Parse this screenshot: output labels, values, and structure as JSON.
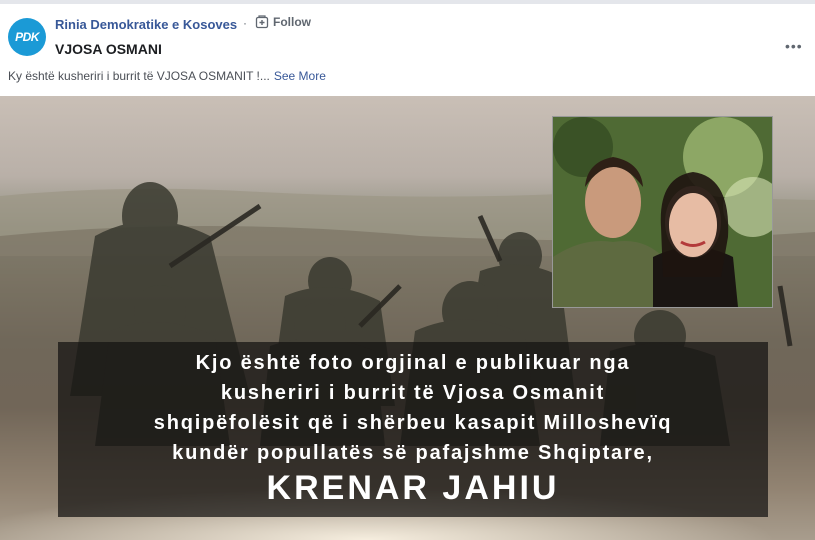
{
  "post": {
    "page_name": "Rinia Demokratike e Kosoves",
    "avatar_text": "PDK",
    "separator": "·",
    "follow_label": "Follow",
    "title": "VJOSA OSMANI",
    "more_label": "•••",
    "text": "Ky është kusheriri i burrit të VJOSA OSMANIT !...",
    "see_more": "See More"
  },
  "image": {
    "caption_lines": [
      "Kjo është foto orgjinal e publikuar nga",
      "kusheriri i burrit të Vjosa Osmanit",
      "shqipëfolësit që i shërbeu kasapit Milloshevïq",
      "kundër popullatës së pafajshme Shqiptare,"
    ],
    "caption_name": "KRENAR JAHIU"
  },
  "colors": {
    "link": "#385898",
    "avatar_bg": "#1b9ad6"
  }
}
